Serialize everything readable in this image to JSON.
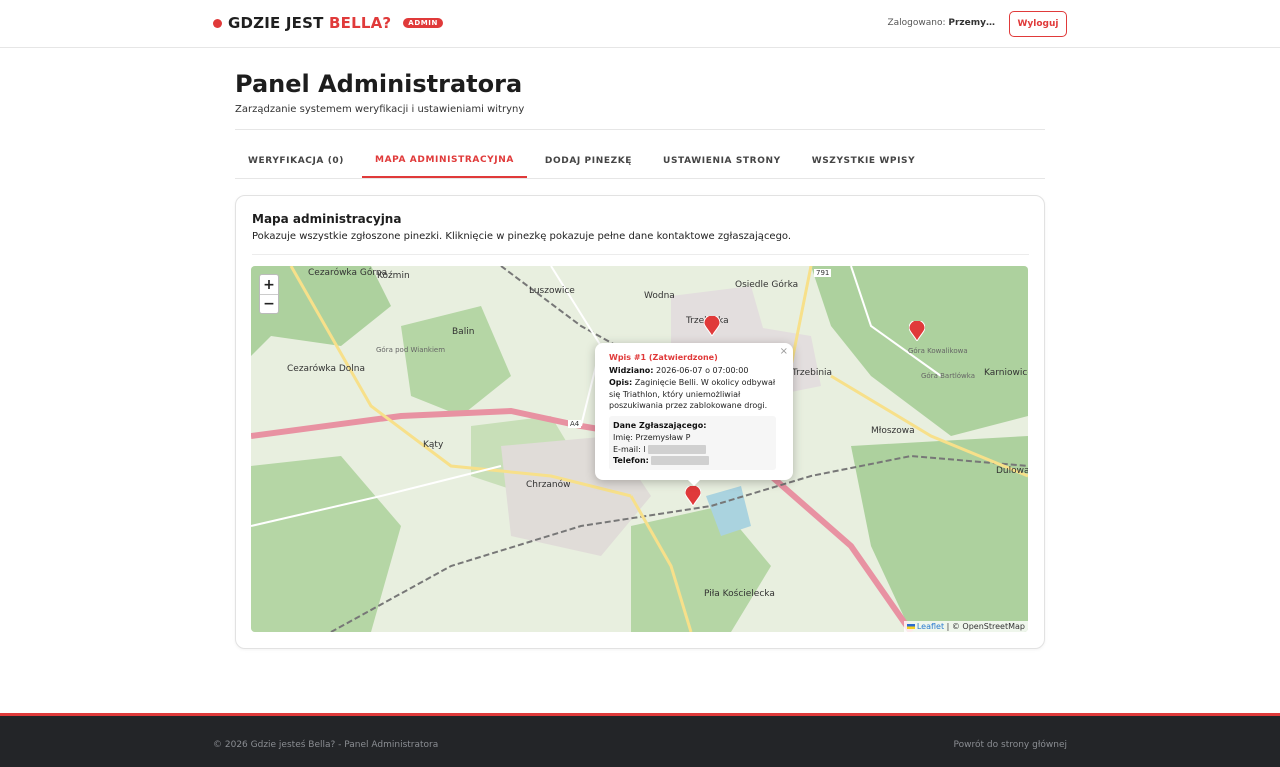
{
  "header": {
    "brand_prefix": "GDZIE JEST ",
    "brand_accent": "BELLA?",
    "badge": "ADMIN",
    "logged_label": "Zalogowano:",
    "logged_user": "Przemy…",
    "logout_label": "Wyloguj"
  },
  "page": {
    "title": "Panel Administratora",
    "subtitle": "Zarządzanie systemem weryfikacji i ustawieniami witryny"
  },
  "tabs": [
    {
      "label": "WERYFIKACJA (0)",
      "active": false
    },
    {
      "label": "MAPA ADMINISTRACYJNA",
      "active": true
    },
    {
      "label": "DODAJ PINEZKĘ",
      "active": false
    },
    {
      "label": "USTAWIENIA STRONY",
      "active": false
    },
    {
      "label": "WSZYSTKIE WPISY",
      "active": false
    }
  ],
  "card": {
    "title": "Mapa administracyjna",
    "description": "Pokazuje wszystkie zgłoszone pinezki. Kliknięcie w pinezkę pokazuje pełne dane kontaktowe zgłaszającego."
  },
  "map": {
    "zoom_in": "+",
    "zoom_out": "−",
    "attribution_leaflet": "Leaflet",
    "attribution_rest": " | © OpenStreetMap",
    "labels": {
      "cezarowka_gorna": "Cezarówka\nGórna",
      "kozmin": "Koźmin",
      "luszowice": "Luszowice",
      "wodna": "Wodna",
      "osiedle_gorka": "Osiedle Górka",
      "trzebinia_n": "Trzebinka",
      "trzebinia": "Trzebinia",
      "balin": "Balin",
      "cezarowka_dolna": "Cezarówka\nDolna",
      "katy": "Kąty",
      "chrzanow": "Chrzanów",
      "mloszowa": "Młoszowa",
      "karniowice": "Karniowice",
      "dulowa": "Dulowa",
      "pila_koscielecka": "Piła Kościelecka",
      "gora_kowalikowa": "Góra Kowalikowa",
      "gora_bartlowka": "Góra Bartlówka",
      "gora_pod_wiankiem": "Góra pod\nWiankiem",
      "a4": "A4",
      "r791": "791"
    },
    "accent_color": "#e03a3a"
  },
  "popup": {
    "close": "×",
    "title": "Wpis #1 (Zatwierdzone)",
    "seen_label": "Widziano:",
    "seen_value": " 2026-06-07 o 07:00:00",
    "desc_label": "Opis:",
    "desc_value": " Zaginięcie Belli. W okolicy odbywał się Triathlon, który uniemożliwiał poszukiwania przez zablokowane drogi.",
    "contact_header": "Dane Zgłaszającego:",
    "name_label": "Imię:",
    "name_value": " Przemysław P",
    "email_label": "E-mail:",
    "email_value": " l",
    "phone_label": "Telefon:",
    "phone_value": ""
  },
  "footer": {
    "left": "© 2026 Gdzie jesteś Bella? - Panel Administratora",
    "right": "Powrót do strony głównej"
  }
}
